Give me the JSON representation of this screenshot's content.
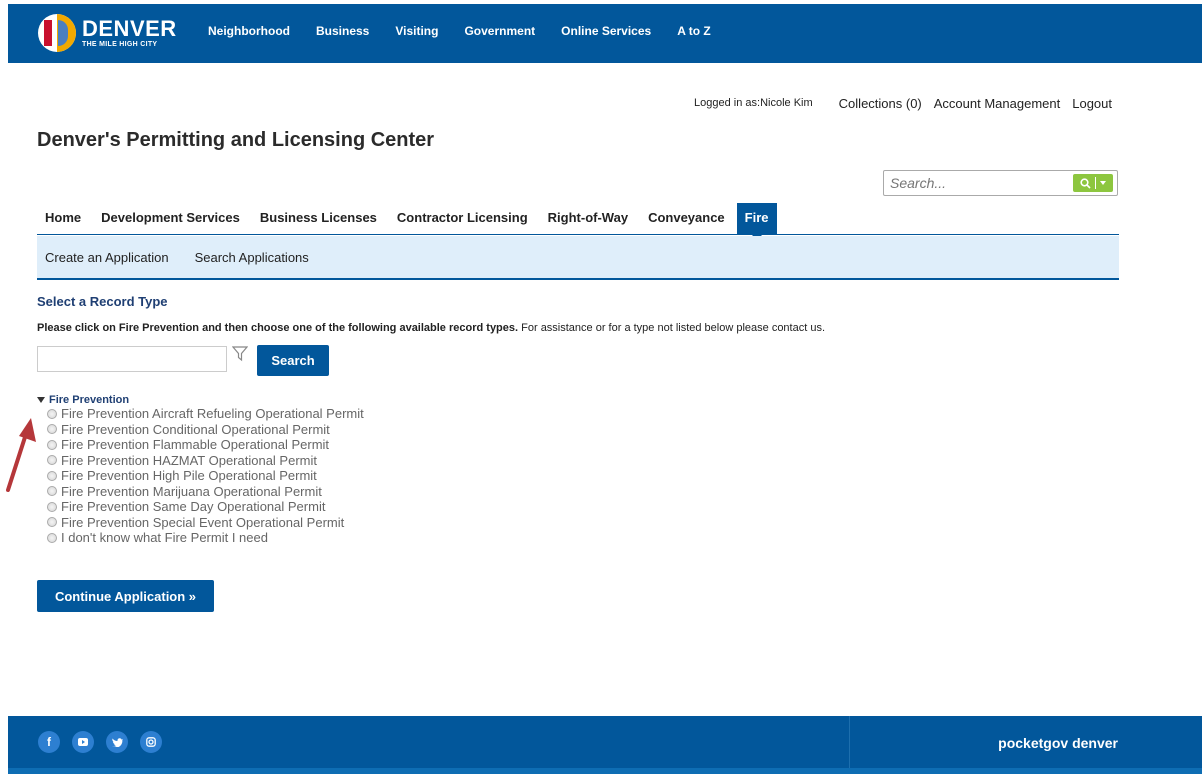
{
  "topbar": {
    "logo_title": "DENVER",
    "logo_sub": "THE MILE HIGH CITY",
    "nav": [
      "Neighborhood",
      "Business",
      "Visiting",
      "Government",
      "Online Services",
      "A to Z"
    ]
  },
  "userbar": {
    "logged_in": "Logged in as:Nicole Kim",
    "collections": "Collections (0)",
    "account": "Account Management",
    "logout": "Logout"
  },
  "page_title": "Denver's Permitting and Licensing Center",
  "search": {
    "placeholder": "Search..."
  },
  "tabs": [
    "Home",
    "Development Services",
    "Business Licenses",
    "Contractor Licensing",
    "Right-of-Way",
    "Conveyance",
    "Fire"
  ],
  "subtabs": [
    "Create an Application",
    "Search Applications"
  ],
  "content": {
    "section_title": "Select a Record Type",
    "instructions_bold": "Please click on Fire Prevention and then choose one of the following available record types.",
    "instructions_rest": " For assistance or for a type not listed below please contact us.",
    "search_button": "Search",
    "tree_heading": "Fire Prevention",
    "options": [
      "Fire Prevention Aircraft Refueling Operational Permit",
      "Fire Prevention Conditional Operational Permit",
      "Fire Prevention Flammable Operational Permit",
      "Fire Prevention HAZMAT Operational Permit",
      "Fire Prevention High Pile Operational Permit",
      "Fire Prevention Marijuana Operational Permit",
      "Fire Prevention Same Day Operational Permit",
      "Fire Prevention Special Event Operational Permit",
      "I don't know what Fire Permit I need"
    ],
    "continue_button": "Continue Application »"
  },
  "footer": {
    "pocketgov": "pocketgov denver",
    "social_icons": [
      "facebook-icon",
      "youtube-icon",
      "twitter-icon",
      "instagram-icon"
    ]
  },
  "colors": {
    "brand_blue": "#02579b",
    "subnav_bg": "#dfeefa",
    "search_green": "#8dc63f",
    "arrow_red": "#b5373a"
  }
}
